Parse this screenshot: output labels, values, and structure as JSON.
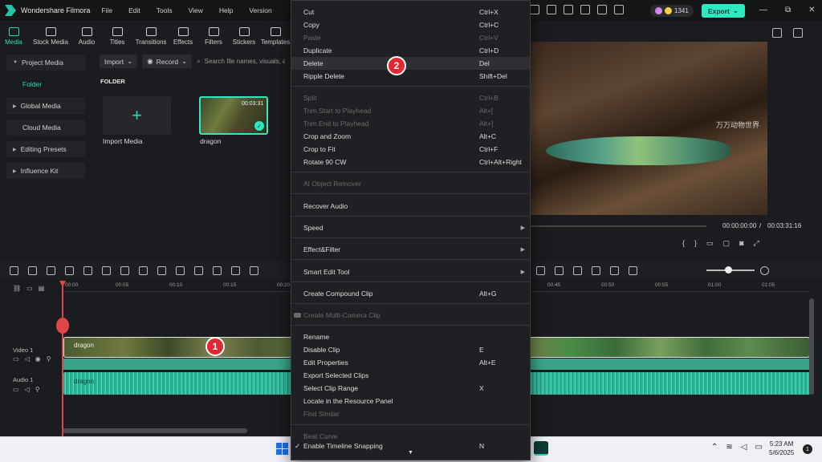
{
  "app": {
    "title": "Wondershare Filmora",
    "menus": [
      "File",
      "Edit",
      "Tools",
      "View",
      "Help",
      "Version"
    ]
  },
  "header": {
    "credits": "1341",
    "export_label": "Export",
    "export_arrow": "⌄",
    "win_min": "—",
    "win_restore": "⧉",
    "win_close": "✕"
  },
  "tabs": [
    {
      "label": "Media"
    },
    {
      "label": "Stock Media"
    },
    {
      "label": "Audio"
    },
    {
      "label": "Titles"
    },
    {
      "label": "Transitions"
    },
    {
      "label": "Effects"
    },
    {
      "label": "Filters"
    },
    {
      "label": "Stickers"
    },
    {
      "label": "Templates"
    }
  ],
  "sidebar": {
    "items": [
      {
        "label": "Project Media",
        "arrow": "▼"
      },
      {
        "label": "Folder"
      },
      {
        "label": "Global Media",
        "arrow": "▶"
      },
      {
        "label": "Cloud Media"
      },
      {
        "label": "Editing Presets",
        "arrow": "▶"
      },
      {
        "label": "Influence Kit",
        "arrow": "▶"
      }
    ]
  },
  "media": {
    "import_label": "Import",
    "record_label": "Record",
    "search_placeholder": "Search file names, visuals, a",
    "folder_heading": "FOLDER",
    "import_media_label": "Import Media",
    "import_plus": "+",
    "clip_name": "dragon",
    "clip_duration": "00:03:31",
    "check": "✓"
  },
  "preview": {
    "watermark": "万万动物世界",
    "current_time": "00:00:00:00",
    "separator": "/",
    "total_time": "00:03:31:16"
  },
  "timeline": {
    "ticks": [
      "00:00",
      "00:05",
      "00:10",
      "00:15",
      "00:20",
      "00:45",
      "00:50",
      "00:55",
      "01:00",
      "01:05"
    ],
    "video_track_label": "Video 1",
    "audio_track_label": "Audio 1",
    "video_clip_label": "dragon",
    "audio_clip_label": "dragon"
  },
  "context_menu": {
    "items": [
      {
        "label": "Cut",
        "shortcut": "Ctrl+X"
      },
      {
        "label": "Copy",
        "shortcut": "Ctrl+C"
      },
      {
        "label": "Paste",
        "shortcut": "Ctrl+V",
        "disabled": true
      },
      {
        "label": "Duplicate",
        "shortcut": "Ctrl+D"
      },
      {
        "label": "Delete",
        "shortcut": "Del",
        "highlighted": true
      },
      {
        "label": "Ripple Delete",
        "shortcut": "Shift+Del"
      },
      {
        "label": "Split",
        "shortcut": "Ctrl+B",
        "disabled": true
      },
      {
        "label": "Trim Start to Playhead",
        "shortcut": "Alt+[",
        "disabled": true
      },
      {
        "label": "Trim End to Playhead",
        "shortcut": "Alt+]",
        "disabled": true
      },
      {
        "label": "Crop and Zoom",
        "shortcut": "Alt+C"
      },
      {
        "label": "Crop to Fit",
        "shortcut": "Ctrl+F"
      },
      {
        "label": "Rotate 90 CW",
        "shortcut": "Ctrl+Alt+Right"
      },
      {
        "label": "AI Object Remover",
        "disabled": true
      },
      {
        "label": "Recover Audio"
      },
      {
        "label": "Speed",
        "submenu": "▶"
      },
      {
        "label": "Effect&Filter",
        "submenu": "▶"
      },
      {
        "label": "Smart Edit Tool",
        "submenu": "▶"
      },
      {
        "label": "Create Compound Clip",
        "shortcut": "Alt+G"
      },
      {
        "label": "Create Multi-Camera Clip",
        "disabled": true
      },
      {
        "label": "Rename"
      },
      {
        "label": "Disable Clip",
        "shortcut": "E"
      },
      {
        "label": "Edit Properties",
        "shortcut": "Alt+E"
      },
      {
        "label": "Export Selected Clips"
      },
      {
        "label": "Select Clip Range",
        "shortcut": "X"
      },
      {
        "label": "Locate in the Resource Panel"
      },
      {
        "label": "Find Similar",
        "disabled": true
      },
      {
        "label": "Beat Curve",
        "disabled": true
      },
      {
        "label": "Enable Timeline Snapping",
        "shortcut": "N",
        "check": "✓"
      }
    ],
    "more_arrow": "▼"
  },
  "badges": {
    "step1": "1",
    "step2": "2"
  },
  "taskbar": {
    "time": "5:23 AM",
    "date": "5/6/2025",
    "notif_count": "1"
  },
  "colors": {
    "accent": "#2ee8c0",
    "badge": "#e3262f",
    "playhead": "#e04646"
  },
  "icons": [
    "media-icon",
    "stock-media-icon",
    "audio-icon",
    "titles-icon",
    "transitions-icon",
    "effects-icon",
    "filters-icon",
    "stickers-icon",
    "templates-icon",
    "search-icon",
    "plus-icon",
    "check-icon",
    "windows-logo-icon",
    "filmora-taskbar-icon",
    "wifi-icon",
    "speaker-icon",
    "battery-icon"
  ]
}
